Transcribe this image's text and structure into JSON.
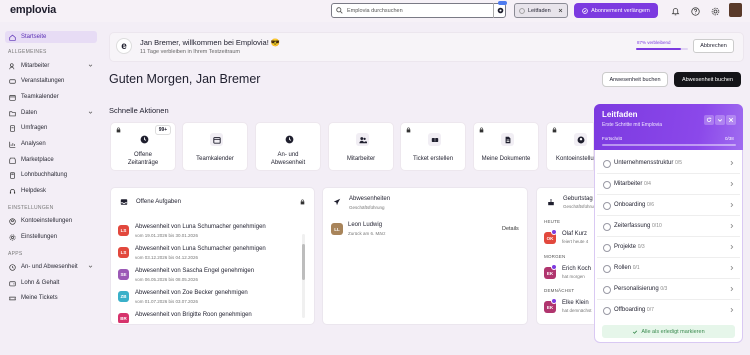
{
  "app": {
    "logo": "emplovia"
  },
  "topbar": {
    "search_placeholder": "Emplovia durchsuchen",
    "leitfaden_label": "Leitfaden",
    "abo_label": "Abonnement verlängern"
  },
  "sidebar": {
    "start": "Startseite",
    "section_general": "ALLGEMEINES",
    "general": [
      "Mitarbeiter",
      "Veranstaltungen",
      "Teamkalender",
      "Daten",
      "Umfragen",
      "Analysen",
      "Marketplace",
      "Lohnbuchhaltung",
      "Helpdesk"
    ],
    "section_settings": "EINSTELLUNGEN",
    "settings": [
      "Kontoeinstellungen",
      "Einstellungen"
    ],
    "section_apps": "APPS",
    "apps": [
      "An- und Abwesenheit",
      "Lohn & Gehalt",
      "Meine Tickets"
    ]
  },
  "welcome": {
    "logo_letter": "e",
    "title": "Jan Bremer, willkommen bei Emplovia! 😎",
    "subtitle": "11 Tage verbleiben in Ihrem Testzeitraum",
    "progress_text": "87% verbleibend",
    "progress": 0.87,
    "cancel": "Abbrechen"
  },
  "main": {
    "greeting": "Guten Morgen, Jan Bremer",
    "book_absence_outline": "Anwesenheit buchen",
    "book_absence_filled": "Abwesenheit buchen",
    "quick_title": "Schnelle Aktionen",
    "badge_count": "99+",
    "quick_actions": [
      "Offene\nZeitanträge",
      "Teamkalender",
      "An- und\nAbwesenheit",
      "Mitarbeiter",
      "Ticket erstellen",
      "Meine Dokumente",
      "Kontoeinstellungen"
    ]
  },
  "open_tasks": {
    "title": "Offene Aufgaben",
    "items": [
      {
        "initials": "LS",
        "color": "#e2483d",
        "title": "Abwesenheit von Luna Schumacher genehmigen",
        "date": "vom 19.01.2026 bis 30.01.2026"
      },
      {
        "initials": "LS",
        "color": "#e2483d",
        "title": "Abwesenheit von Luna Schumacher genehmigen",
        "date": "vom 03.12.2026 bis 04.12.2026"
      },
      {
        "initials": "SE",
        "color": "#9b59b6",
        "title": "Abwesenheit von Sascha Engel genehmigen",
        "date": "vom 06.05.2026 bis 08.05.2026"
      },
      {
        "initials": "ZB",
        "color": "#3ab0c9",
        "title": "Abwesenheit von Zoe Becker genehmigen",
        "date": "vom 01.07.2026 bis 03.07.2026"
      },
      {
        "initials": "BR",
        "color": "#d6336c",
        "title": "Abwesenheit von Brigitte Roon genehmigen",
        "date": ""
      }
    ]
  },
  "absences": {
    "title": "Abwesenheiten",
    "subtitle": "Geschäftsführung",
    "person_initials": "LL",
    "person": "Leon Ludwig",
    "person_sub": "Zurück am 6. März",
    "details": "Details"
  },
  "birthdays": {
    "title": "Geburtstag",
    "subtitle": "Geschäftsführung",
    "today_label": "HEUTE",
    "tomorrow_label": "MORGEN",
    "soon_label": "DEMNÄCHST",
    "today": {
      "initials": "OK",
      "name": "Olaf Kurz",
      "sub": "feiert heute 4"
    },
    "tomorrow": {
      "initials": "EK",
      "name": "Erich Koch",
      "sub": "hat morgen"
    },
    "soon": {
      "initials": "EK",
      "name": "Elke Klein",
      "sub": "hat demnächst"
    }
  },
  "guide": {
    "title": "Leitfaden",
    "subtitle": "Erste Schritte mit Emplovia",
    "progress_label": "Fortschritt",
    "progress_value": "0/38",
    "items": [
      {
        "label": "Unternehmensstruktur",
        "count": "0/5"
      },
      {
        "label": "Mitarbeiter",
        "count": "0/4"
      },
      {
        "label": "Onboarding",
        "count": "0/6"
      },
      {
        "label": "Zeiterfassung",
        "count": "0/10"
      },
      {
        "label": "Projekte",
        "count": "0/3"
      },
      {
        "label": "Rollen",
        "count": "0/1"
      },
      {
        "label": "Personalisierung",
        "count": "0/3"
      },
      {
        "label": "Offboarding",
        "count": "0/7"
      }
    ],
    "done_label": "Alle als erledigt markieren"
  },
  "colors": {
    "accent": "#7c3ae0",
    "dark": "#141418"
  }
}
